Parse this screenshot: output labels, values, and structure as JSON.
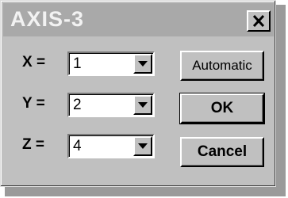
{
  "window": {
    "title": "AXIS-3",
    "close_icon": "close-icon"
  },
  "fields": [
    {
      "label": "X =",
      "value": "1"
    },
    {
      "label": "Y =",
      "value": "2"
    },
    {
      "label": "Z =",
      "value": "4"
    }
  ],
  "buttons": {
    "automatic": "Automatic",
    "ok": "OK",
    "cancel": "Cancel"
  },
  "icons": {
    "dropdown": "chevron-down-icon"
  },
  "colors": {
    "face": "#c0c0c0",
    "titlebar": "#a9a9a9",
    "title_text": "#f2f2f2"
  }
}
